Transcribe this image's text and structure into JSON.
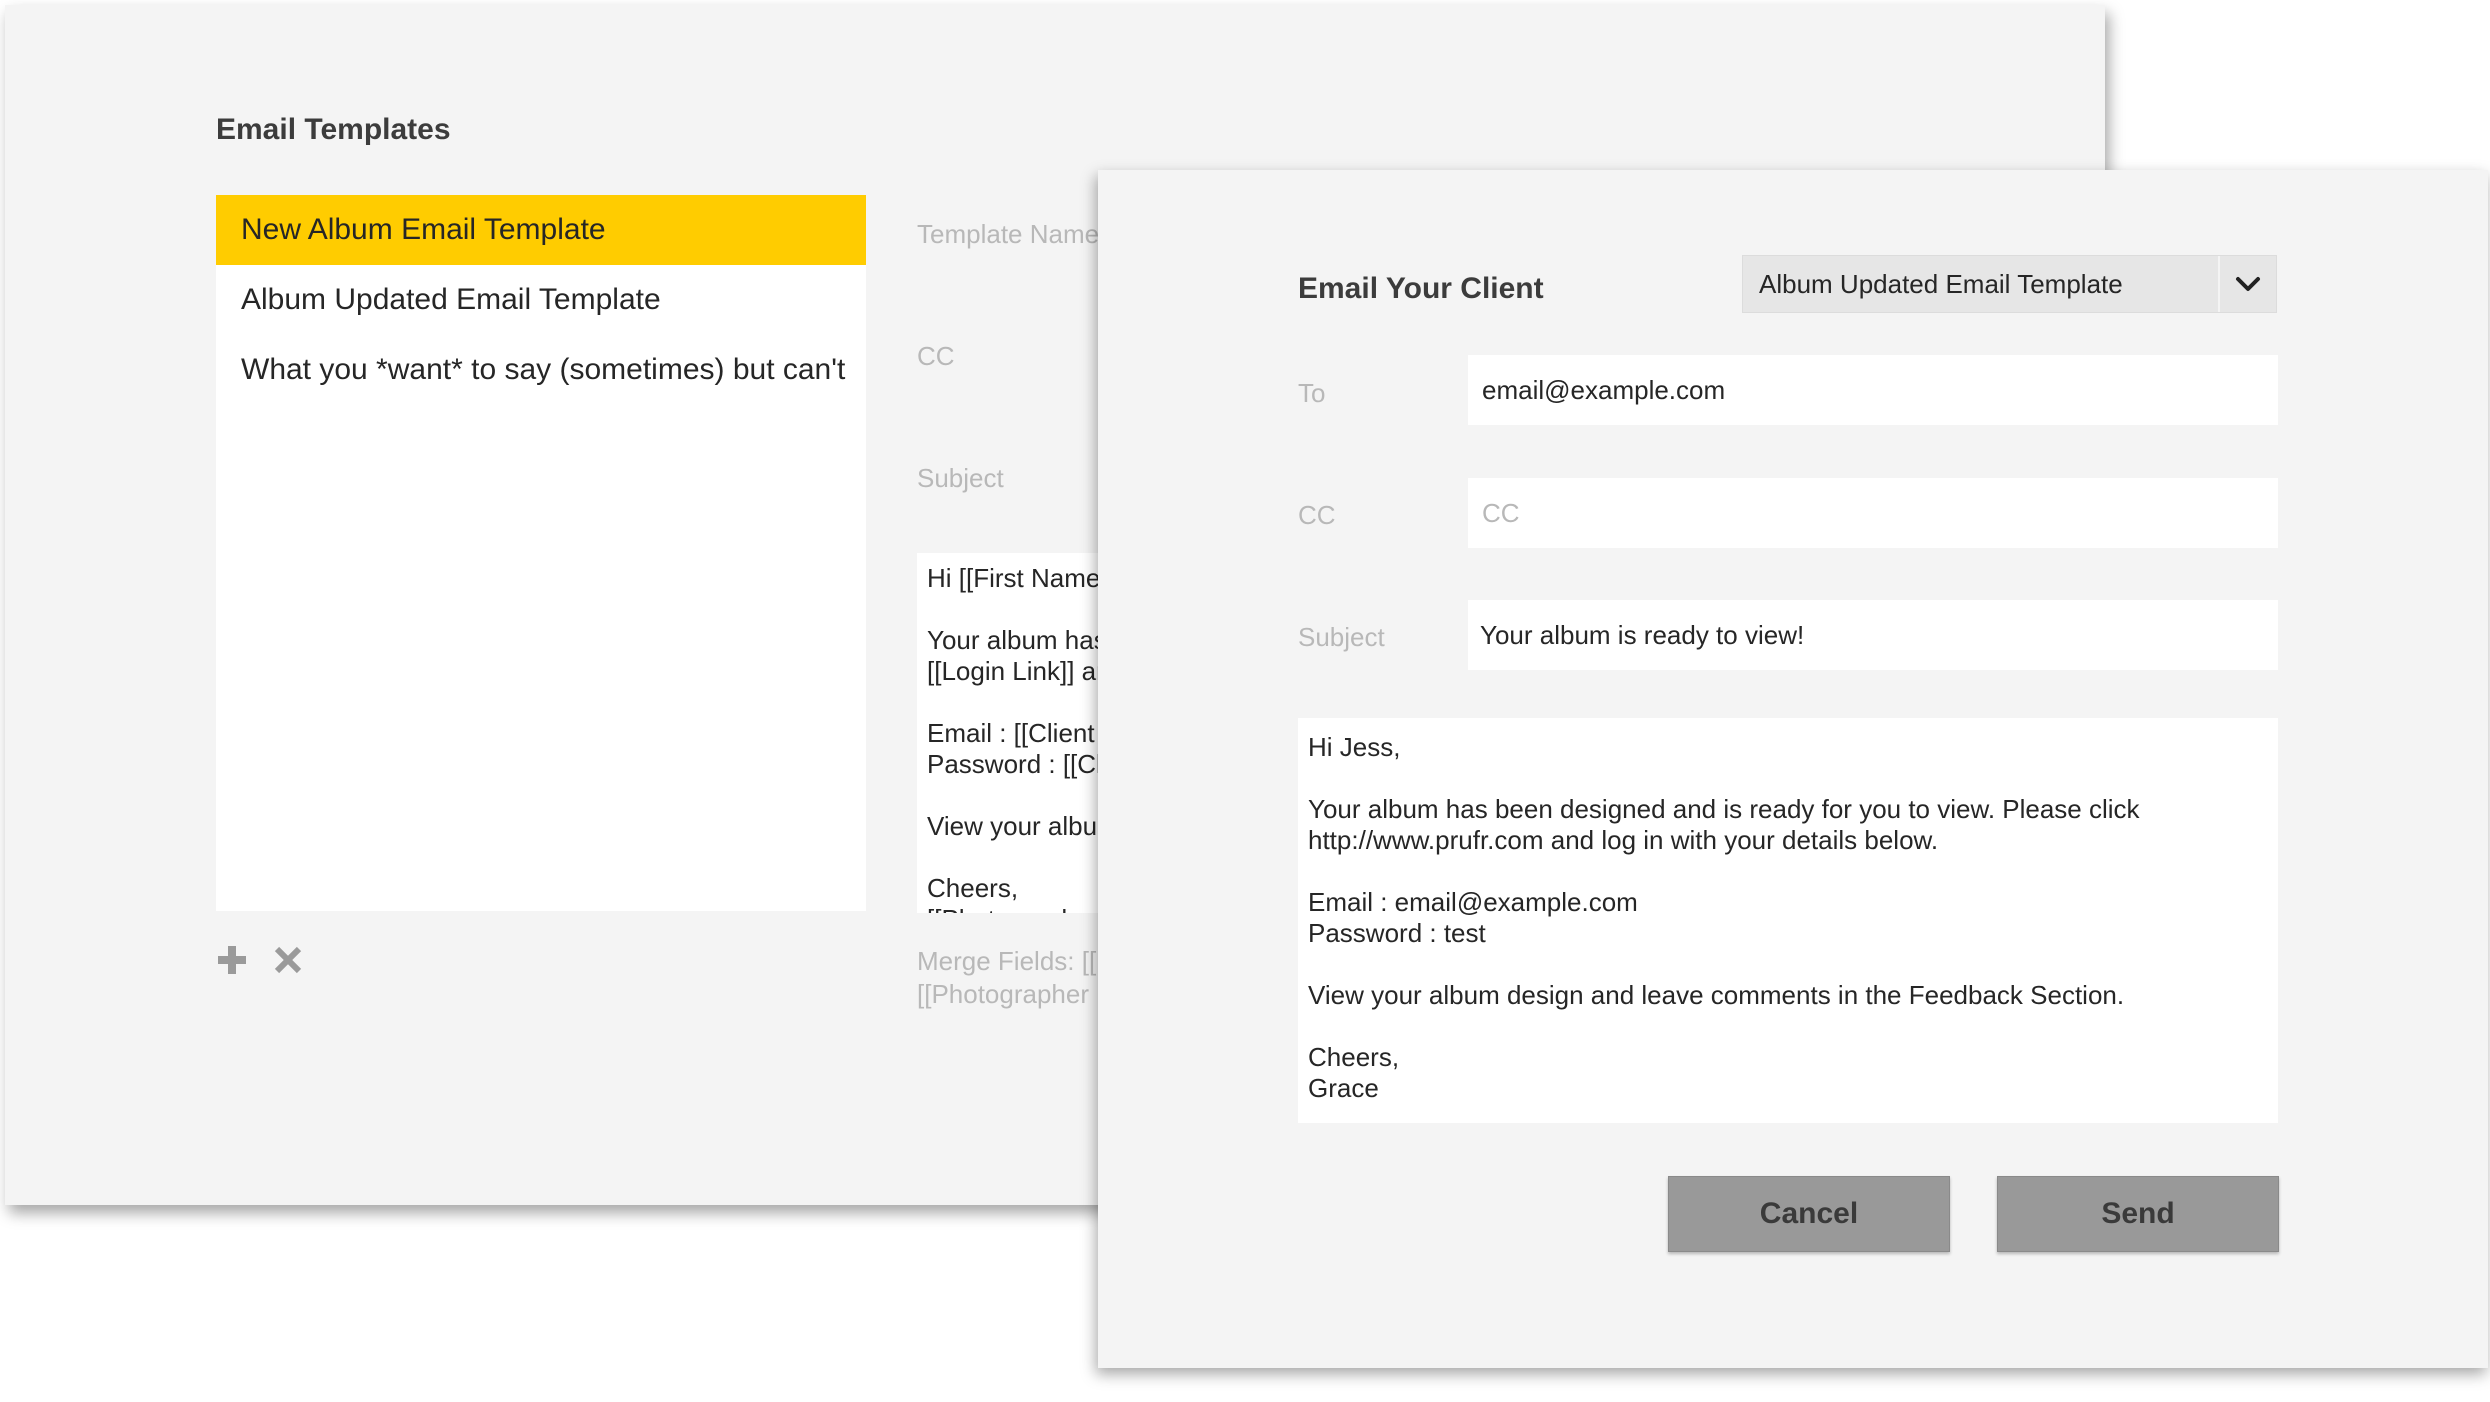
{
  "templates_panel": {
    "title": "Email Templates",
    "items": [
      {
        "label": "New Album Email Template",
        "selected": true
      },
      {
        "label": "Album Updated Email Template",
        "selected": false
      },
      {
        "label": "What you *want* to say (sometimes) but can't",
        "selected": false
      }
    ],
    "add_icon": "plus-icon",
    "delete_icon": "close-icon",
    "template_name_label": "Template Name",
    "cc_label": "CC",
    "subject_label": "Subject",
    "body_lines": [
      "Hi [[First Name]],",
      "",
      "Your album has been designed and is ready for you to view. Please click",
      "[[Login Link]] and log in with your details below.",
      "",
      "Email : [[Client Email]]",
      "Password : [[Client Password]]",
      "",
      "View your album design and leave comments in the Feedback Section.",
      "",
      "Cheers,",
      "[[Photographer Name]]"
    ],
    "merge_fields_line1": "Merge Fields: [[First Name]]",
    "merge_fields_line2": "[[Photographer Name]]"
  },
  "email_modal": {
    "title": "Email Your Client",
    "template_select": {
      "selected": "Album Updated Email Template",
      "chevron_icon": "chevron-down-icon"
    },
    "to_label": "To",
    "to_value": "email@example.com",
    "cc_label": "CC",
    "cc_placeholder": "CC",
    "cc_value": "",
    "subject_label": "Subject",
    "subject_value": "Your album is ready to view!",
    "body_lines": [
      "Hi Jess,",
      "",
      "Your album has been designed and is ready for you to view. Please click",
      "http://www.prufr.com and log in with your details below.",
      "",
      "Email : email@example.com",
      "Password : test",
      "",
      "View your album design and leave comments in the Feedback Section.",
      "",
      "Cheers,",
      "Grace"
    ],
    "cancel_label": "Cancel",
    "send_label": "Send"
  },
  "colors": {
    "selected_item": "#ffcc00",
    "panel_bg": "#f4f4f4",
    "button_bg": "#999999",
    "label_text": "#b8b8b8"
  }
}
